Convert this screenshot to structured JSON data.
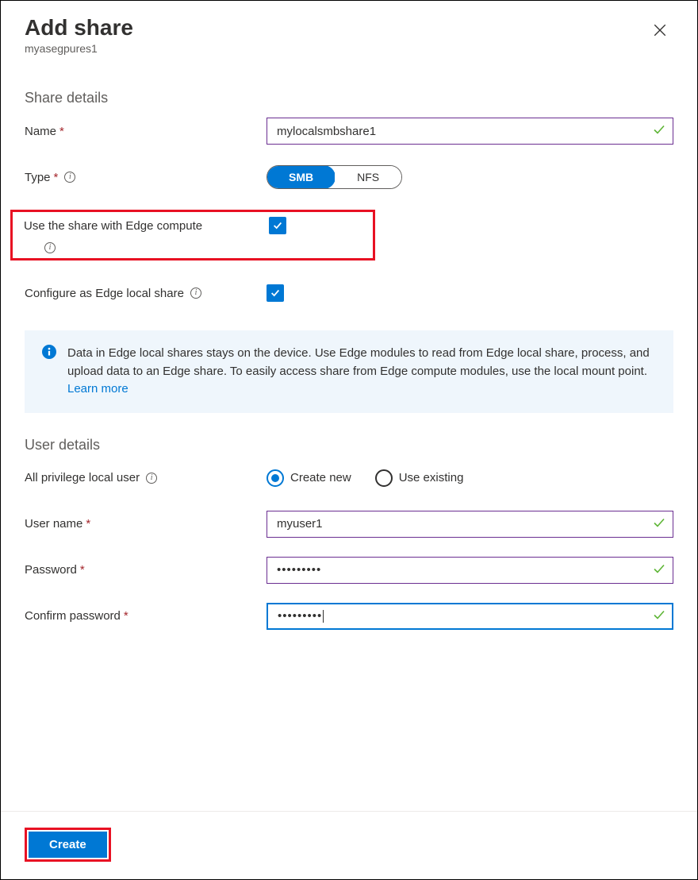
{
  "header": {
    "title": "Add share",
    "subtitle": "myasegpures1"
  },
  "share_details": {
    "section_label": "Share details",
    "name_label": "Name",
    "name_value": "mylocalsmbshare1",
    "type_label": "Type",
    "type_options": {
      "smb": "SMB",
      "nfs": "NFS"
    },
    "type_selected": "smb",
    "edge_compute_label": "Use the share with Edge compute",
    "edge_compute_checked": true,
    "edge_local_label": "Configure as Edge local share",
    "edge_local_checked": true
  },
  "info_box": {
    "text": "Data in Edge local shares stays on the device. Use Edge modules to read from Edge local share, process, and upload data to an Edge share. To easily access share from Edge compute modules, use the local mount point. ",
    "link": "Learn more"
  },
  "user_details": {
    "section_label": "User details",
    "privilege_label": "All privilege local user",
    "radio_create": "Create new",
    "radio_existing": "Use existing",
    "radio_selected": "create",
    "username_label": "User name",
    "username_value": "myuser1",
    "password_label": "Password",
    "password_value": "•••••••••",
    "confirm_label": "Confirm password",
    "confirm_value": "•••••••••"
  },
  "footer": {
    "create_label": "Create"
  }
}
